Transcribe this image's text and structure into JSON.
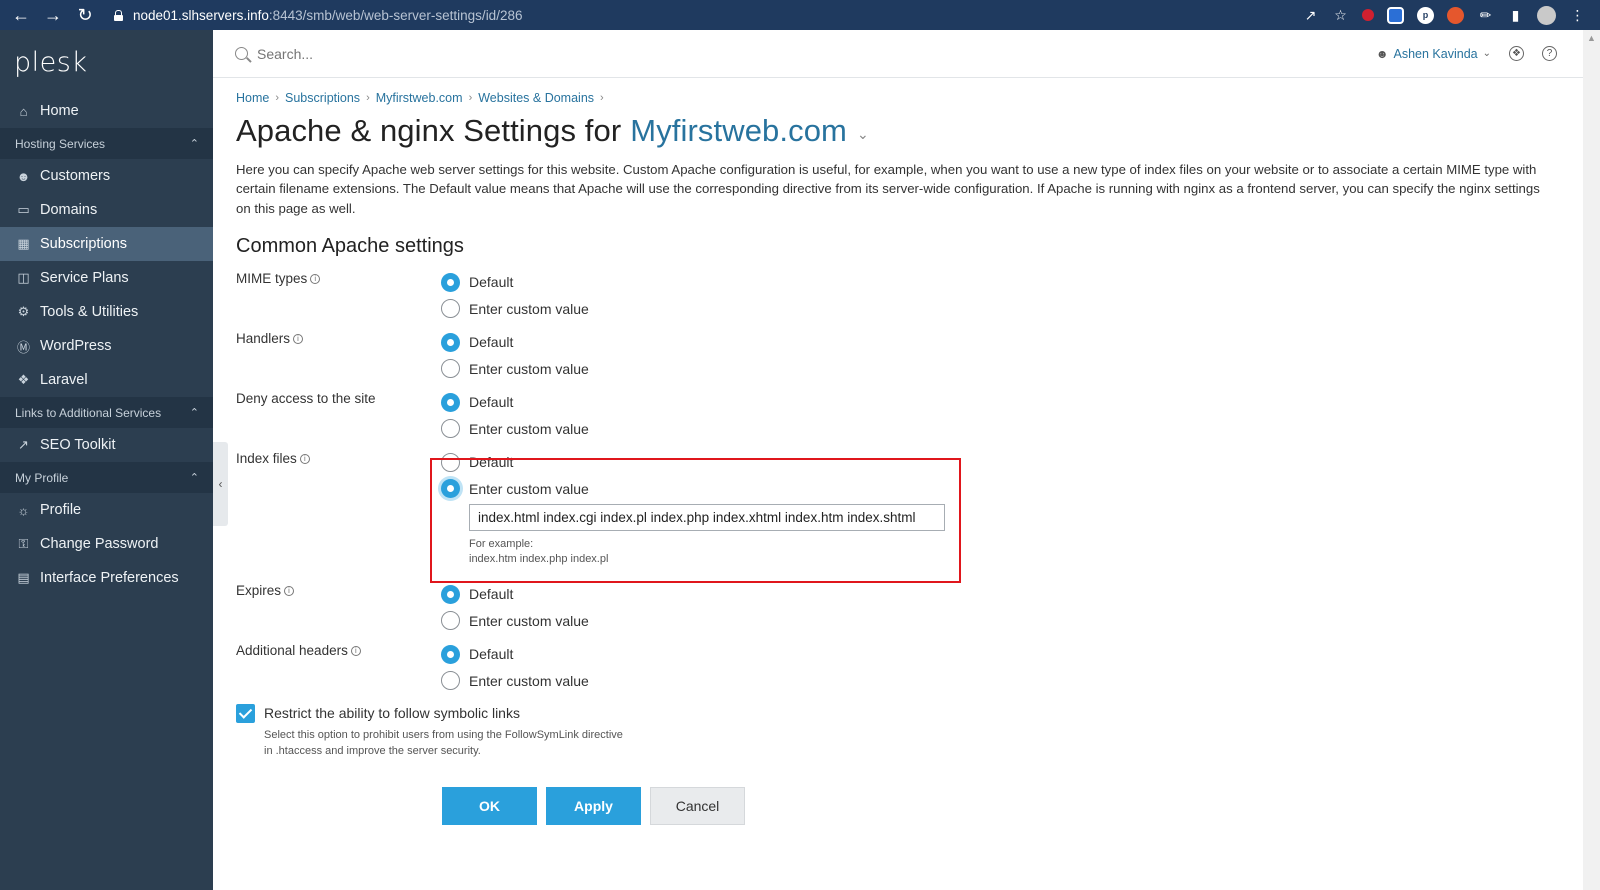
{
  "browser": {
    "url_host": "node01.slhservers.info",
    "url_path": ":8443/smb/web/web-server-settings/id/286"
  },
  "sidebar": {
    "logo": "plesk",
    "home": "Home",
    "group_hosting": "Hosting Services",
    "items_hosting": [
      "Customers",
      "Domains",
      "Subscriptions",
      "Service Plans",
      "Tools & Utilities",
      "WordPress",
      "Laravel"
    ],
    "group_links": "Links to Additional Services",
    "items_links": [
      "SEO Toolkit"
    ],
    "group_profile": "My Profile",
    "items_profile": [
      "Profile",
      "Change Password",
      "Interface Preferences"
    ],
    "active_item": "Subscriptions"
  },
  "topbar": {
    "search_placeholder": "Search...",
    "user_name": "Ashen Kavinda"
  },
  "breadcrumb": [
    "Home",
    "Subscriptions",
    "Myfirstweb.com",
    "Websites & Domains"
  ],
  "page": {
    "title_prefix": "Apache & nginx Settings for",
    "title_site": "Myfirstweb.com",
    "intro": "Here you can specify Apache web server settings for this website. Custom Apache configuration is useful, for example, when you want to use a new type of index files on your website or to associate a certain MIME type with certain filename extensions. The Default value means that Apache will use the corresponding directive from its server-wide configuration. If Apache is running with nginx as a frontend server, you can specify the nginx settings on this page as well.",
    "section_title": "Common Apache settings"
  },
  "settings": {
    "option_default": "Default",
    "option_custom": "Enter custom value",
    "mime_types": {
      "label": "MIME types",
      "selected": "Default"
    },
    "handlers": {
      "label": "Handlers",
      "selected": "Default"
    },
    "deny_access": {
      "label": "Deny access to the site",
      "selected": "Default"
    },
    "index_files": {
      "label": "Index files",
      "selected": "Enter custom value",
      "value": "index.html index.cgi index.pl index.php index.xhtml index.htm index.shtml",
      "hint_title": "For example:",
      "hint_example": "index.htm index.php index.pl"
    },
    "expires": {
      "label": "Expires",
      "selected": "Default"
    },
    "additional_headers": {
      "label": "Additional headers",
      "selected": "Default"
    }
  },
  "symlinks": {
    "checked": true,
    "label": "Restrict the ability to follow symbolic links",
    "description": "Select this option to prohibit users from using the FollowSymLink directive in .htaccess and improve the server security."
  },
  "buttons": {
    "ok": "OK",
    "apply": "Apply",
    "cancel": "Cancel"
  },
  "colors": {
    "accent": "#2aa0dc",
    "sidebar_bg": "#2c3e50",
    "link": "#28739e",
    "highlight_border": "#e0161c"
  }
}
